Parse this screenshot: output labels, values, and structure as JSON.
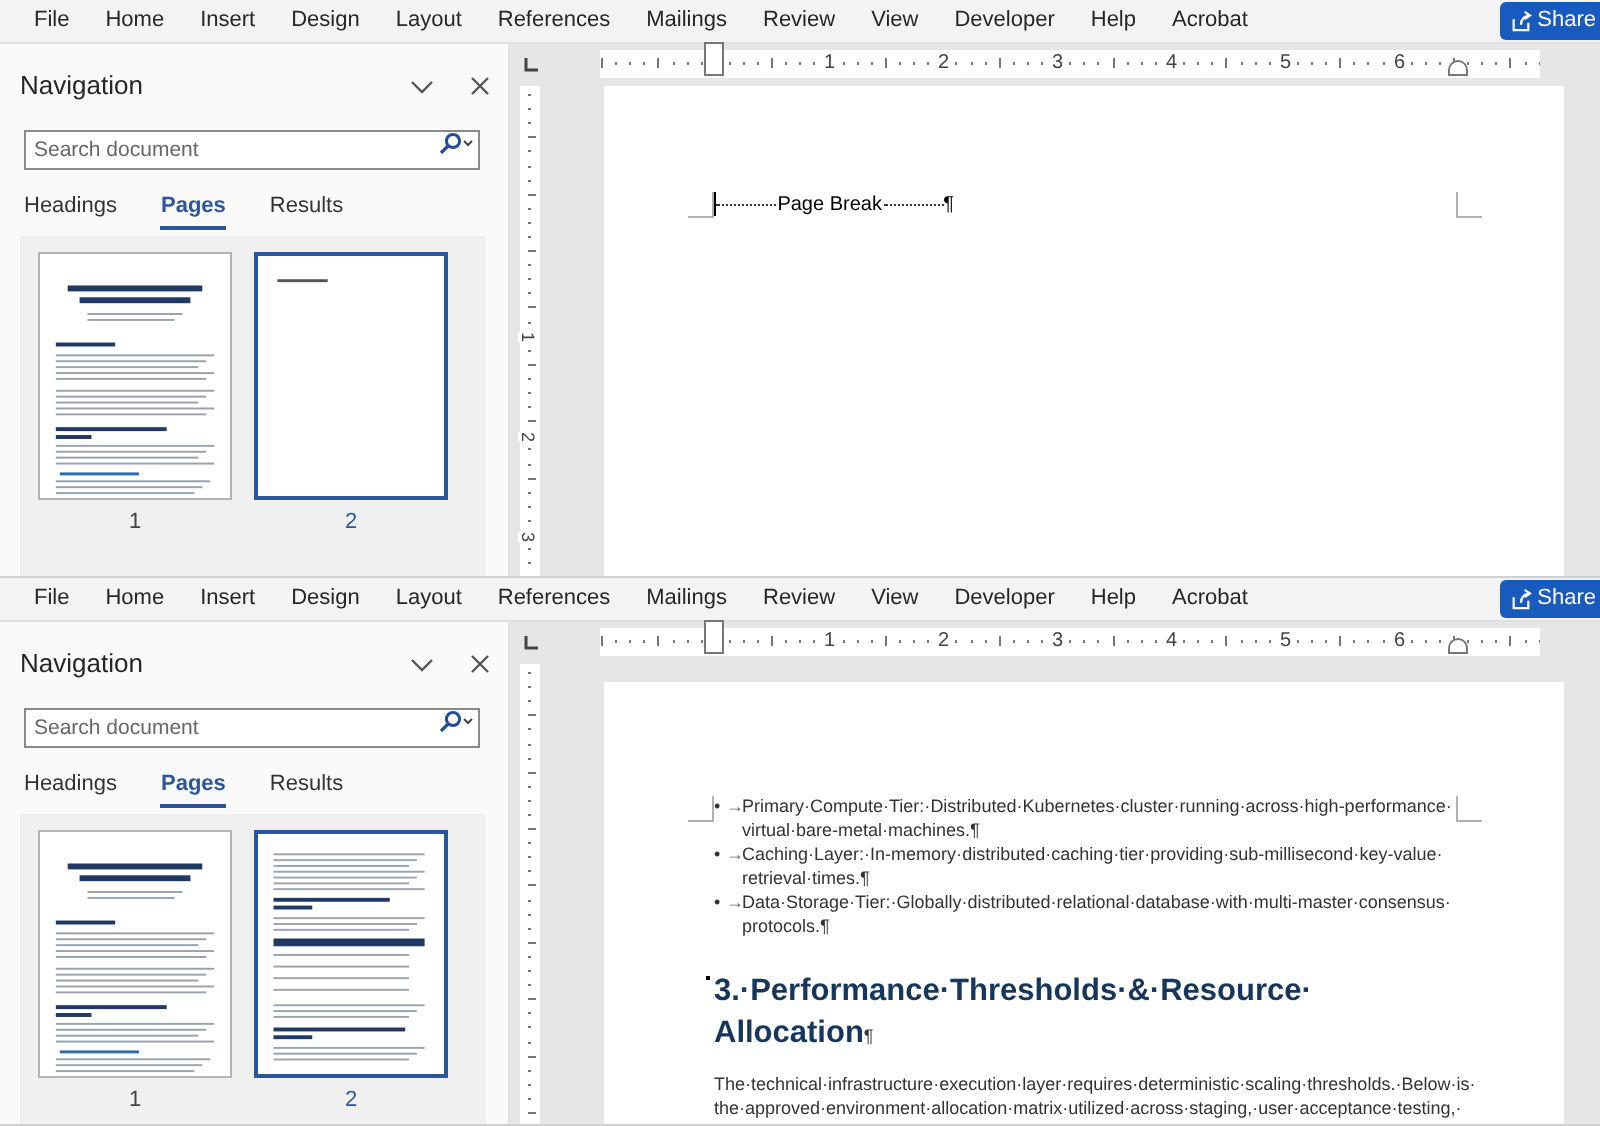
{
  "panes": [
    {
      "menu": [
        "File",
        "Home",
        "Insert",
        "Design",
        "Layout",
        "References",
        "Mailings",
        "Review",
        "View",
        "Developer",
        "Help",
        "Acrobat"
      ],
      "share": "Share",
      "navigation": {
        "title": "Navigation",
        "search": {
          "placeholder": "Search document"
        },
        "tabs": [
          {
            "label": "Headings",
            "selected": false
          },
          {
            "label": "Pages",
            "selected": true
          },
          {
            "label": "Results",
            "selected": false
          }
        ],
        "pages": [
          {
            "number": "1",
            "selected": false,
            "kind": "title-page"
          },
          {
            "number": "2",
            "selected": true,
            "kind": "page-break"
          }
        ]
      },
      "ruler_numbers": [
        "1",
        "2",
        "3",
        "4",
        "5",
        "6"
      ],
      "vertical_ruler_numbers": [
        "1",
        "2",
        "3"
      ],
      "page_content": [
        {
          "kind": "page_break",
          "label": "Page Break",
          "mark": "¶"
        }
      ]
    },
    {
      "menu": [
        "File",
        "Home",
        "Insert",
        "Design",
        "Layout",
        "References",
        "Mailings",
        "Review",
        "View",
        "Developer",
        "Help",
        "Acrobat"
      ],
      "share": "Share",
      "navigation": {
        "title": "Navigation",
        "search": {
          "placeholder": "Search document"
        },
        "tabs": [
          {
            "label": "Headings",
            "selected": false
          },
          {
            "label": "Pages",
            "selected": true
          },
          {
            "label": "Results",
            "selected": false
          }
        ],
        "pages": [
          {
            "number": "1",
            "selected": false,
            "kind": "title-page"
          },
          {
            "number": "2",
            "selected": true,
            "kind": "table-page"
          }
        ]
      },
      "ruler_numbers": [
        "1",
        "2",
        "3",
        "4",
        "5",
        "6"
      ],
      "page_content": [
        {
          "kind": "bullet",
          "bullet": "•",
          "arrow": "→",
          "text": "Primary·Compute·Tier:·Distributed·Kubernetes·cluster·running·across·high-performance·virtual·bare-metal·machines.¶"
        },
        {
          "kind": "bullet",
          "bullet": "•",
          "arrow": "→",
          "text": "Caching·Layer:·In-memory·distributed·caching·tier·providing·sub-millisecond·key-value·retrieval·times.¶"
        },
        {
          "kind": "bullet",
          "bullet": "•",
          "arrow": "→",
          "text": "Data·Storage·Tier:·Globally·distributed·relational·database·with·multi-master·consensus·protocols.¶"
        },
        {
          "kind": "heading",
          "keep_with_next": true,
          "text": "3.·Performance·Thresholds·&·Resource·Allocation",
          "mark": "¶"
        },
        {
          "kind": "paragraph",
          "text": "The·technical·infrastructure·execution·layer·requires·deterministic·scaling·thresholds.·Below·is·the·approved·environment·allocation·matrix·utilized·across·staging,·user·acceptance·testing,·"
        }
      ]
    }
  ]
}
